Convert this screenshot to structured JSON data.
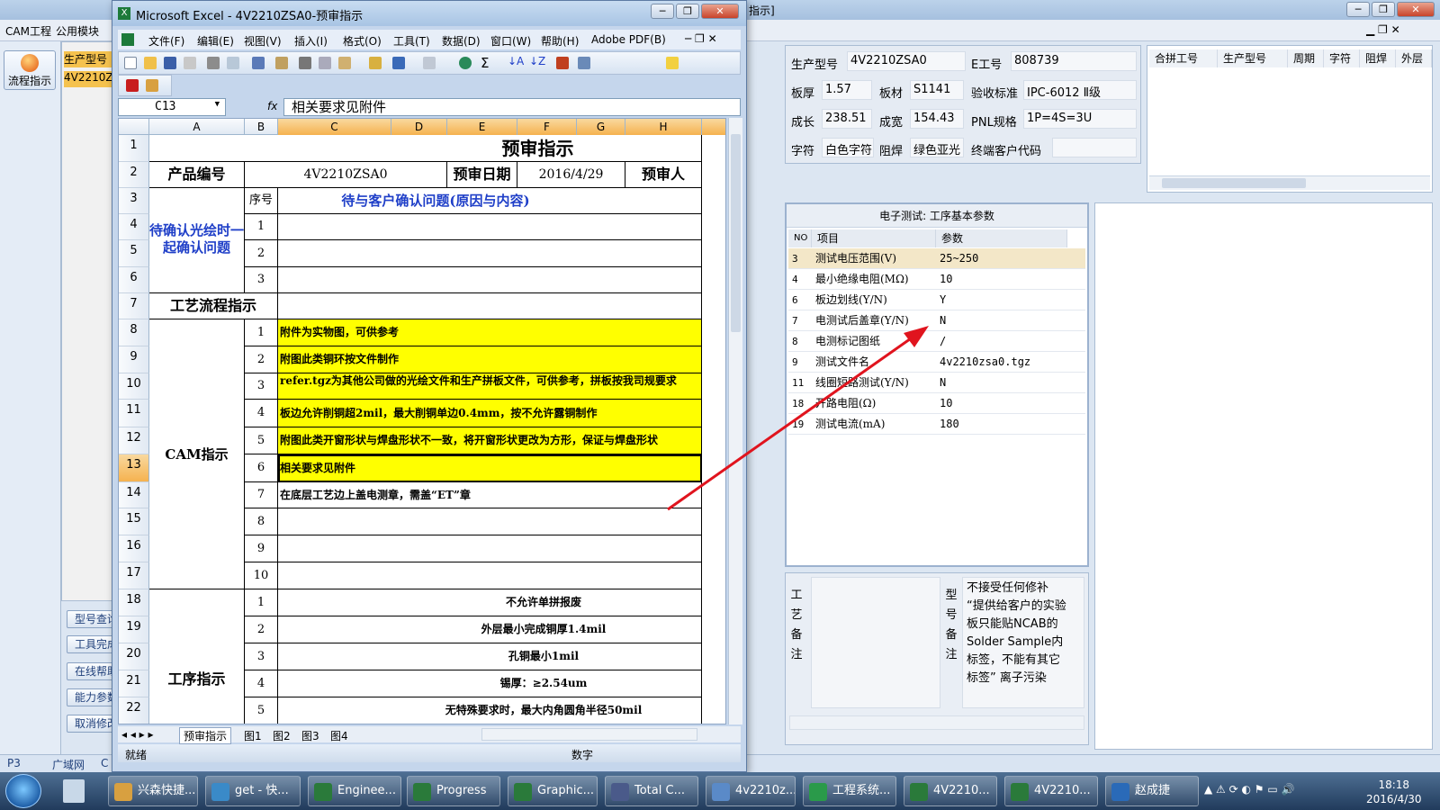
{
  "background_app": {
    "title_fragment": "指示]",
    "menu": [
      "CAM工程",
      "公用模块"
    ],
    "flow_button": "流程指示",
    "list_items": [
      "生产型号",
      "4V2210Z"
    ],
    "side_buttons": [
      "型号查询",
      "工具完成",
      "在线帮助",
      "能力参数",
      "取消修改"
    ],
    "status_left": [
      "P3",
      "广域网",
      "C"
    ]
  },
  "excel": {
    "title": "Microsoft Excel - 4V2210ZSA0-预审指示",
    "menus": [
      "文件(F)",
      "编辑(E)",
      "视图(V)",
      "插入(I)",
      "格式(O)",
      "工具(T)",
      "数据(D)",
      "窗口(W)",
      "帮助(H)",
      "Adobe PDF(B)"
    ],
    "name_box": "C13",
    "fx": "fx",
    "formula": "相关要求见附件",
    "columns": [
      "A",
      "B",
      "C",
      "D",
      "E",
      "F",
      "G",
      "H"
    ],
    "rows": [
      "1",
      "2",
      "3",
      "4",
      "5",
      "6",
      "7",
      "8",
      "9",
      "10",
      "11",
      "12",
      "13",
      "14",
      "15",
      "16",
      "17",
      "18",
      "19",
      "20",
      "21",
      "22"
    ],
    "cells": {
      "title": "预审指示",
      "product_no_label": "产品编号",
      "product_no": "4V2210ZSA0",
      "review_date_label": "预审日期",
      "review_date": "2016/4/29",
      "reviewer_label": "预审人",
      "pending_label": "待确认光绘时一起确认问题",
      "seq_label": "序号",
      "pending_header": "待与客户确认问题(原因与内容)",
      "pending_nums": [
        "1",
        "2",
        "3"
      ],
      "flow_label": "工艺流程指示",
      "cam_label": "CAM指示",
      "cam_items": [
        {
          "n": "1",
          "text": "附件为实物图，可供参考",
          "yellow": true
        },
        {
          "n": "2",
          "text": "附图此类铜环按文件制作",
          "yellow": true
        },
        {
          "n": "3",
          "text": "refer.tgz为其他公司做的光绘文件和生产拼板文件，可供参考，拼板按我司规要求",
          "yellow": true
        },
        {
          "n": "4",
          "text": "板边允许削铜超2mil，最大削铜单边0.4mm，按不允许露铜制作",
          "yellow": true
        },
        {
          "n": "5",
          "text": "附图此类开窗形状与焊盘形状不一致，将开窗形状更改为方形，保证与焊盘形状",
          "yellow": true
        },
        {
          "n": "6",
          "text": "相关要求见附件",
          "yellow": true
        },
        {
          "n": "7",
          "text": "在底层工艺边上盖电测章，需盖“ET”章",
          "yellow": false
        },
        {
          "n": "8",
          "text": "",
          "yellow": false
        },
        {
          "n": "9",
          "text": "",
          "yellow": false
        },
        {
          "n": "10",
          "text": "",
          "yellow": false
        }
      ],
      "process_label": "工序指示",
      "process_items": [
        {
          "n": "1",
          "text": "不允许单拼报废"
        },
        {
          "n": "2",
          "text": "外层最小完成铜厚1.4mil"
        },
        {
          "n": "3",
          "text": "孔铜最小1mil"
        },
        {
          "n": "4",
          "text": "锡厚：≥2.54um"
        },
        {
          "n": "5",
          "text": "无特殊要求时，最大内角圆角半径50mil"
        }
      ]
    },
    "sheet_tabs": [
      "预审指示",
      "图1",
      "图2",
      "图3",
      "图4"
    ],
    "status_ready": "就绪",
    "status_num": "数字"
  },
  "info": {
    "model_label": "生产型号",
    "model": "4V2210ZSA0",
    "eno_label": "E工号",
    "eno": "808739",
    "thickness_label": "板厚",
    "thickness": "1.57",
    "material_label": "板材",
    "material": "S1141",
    "standard_label": "验收标准",
    "standard": "IPC-6012 Ⅱ级",
    "length_label": "成长",
    "length": "238.51",
    "width_label": "成宽",
    "width": "154.43",
    "pnl_label": "PNL规格",
    "pnl": "1P=4S=3U",
    "char_label": "字符",
    "char": "白色字符",
    "mask_label": "阻焊",
    "mask": "绿色亚光",
    "customer_code_label": "终端客户代码",
    "customer_code": ""
  },
  "grid1_headers": [
    "合拼工号",
    "生产型号",
    "周期",
    "字符",
    "阻焊",
    "外层"
  ],
  "et": {
    "title": "电子测试: 工序基本参数",
    "headers": [
      "NO",
      "项目",
      "参数"
    ],
    "rows": [
      {
        "no": "3",
        "item": "测试电压范围(V)",
        "param": "25~250"
      },
      {
        "no": "4",
        "item": "最小绝缘电阻(MΩ)",
        "param": "10"
      },
      {
        "no": "6",
        "item": "板边划线(Y/N)",
        "param": "Y"
      },
      {
        "no": "7",
        "item": "电测试后盖章(Y/N)",
        "param": "N"
      },
      {
        "no": "8",
        "item": "电测标记图纸",
        "param": "/"
      },
      {
        "no": "9",
        "item": "测试文件名",
        "param": "4v2210zsa0.tgz"
      },
      {
        "no": "11",
        "item": "线圈短路测试(Y/N)",
        "param": "N"
      },
      {
        "no": "18",
        "item": "开路电阻(Ω)",
        "param": "10"
      },
      {
        "no": "19",
        "item": "测试电流(mA)",
        "param": "180"
      }
    ]
  },
  "notes": {
    "process_note_label": "工艺备注",
    "model_note_label": "型号备注",
    "model_note": "不接受任何修补 “提供给客户的实验板只能贴NCAB的Solder Sample内标签，不能有其它标签” 离子污染"
  },
  "taskbar": {
    "items": [
      "兴森快捷...",
      "get - 快...",
      "Enginee...",
      "Progress",
      "Graphic...",
      "Total C...",
      "4v2210z...",
      "工程系统...",
      "4V2210...",
      "4V2210...",
      "赵成捷"
    ],
    "time": "18:18",
    "date": "2016/4/30"
  },
  "colors": {
    "highlight": "#ffff00",
    "arrow": "#e0141e",
    "blue_text": "#1f3fc8",
    "sel_header": "#f5b24f"
  }
}
